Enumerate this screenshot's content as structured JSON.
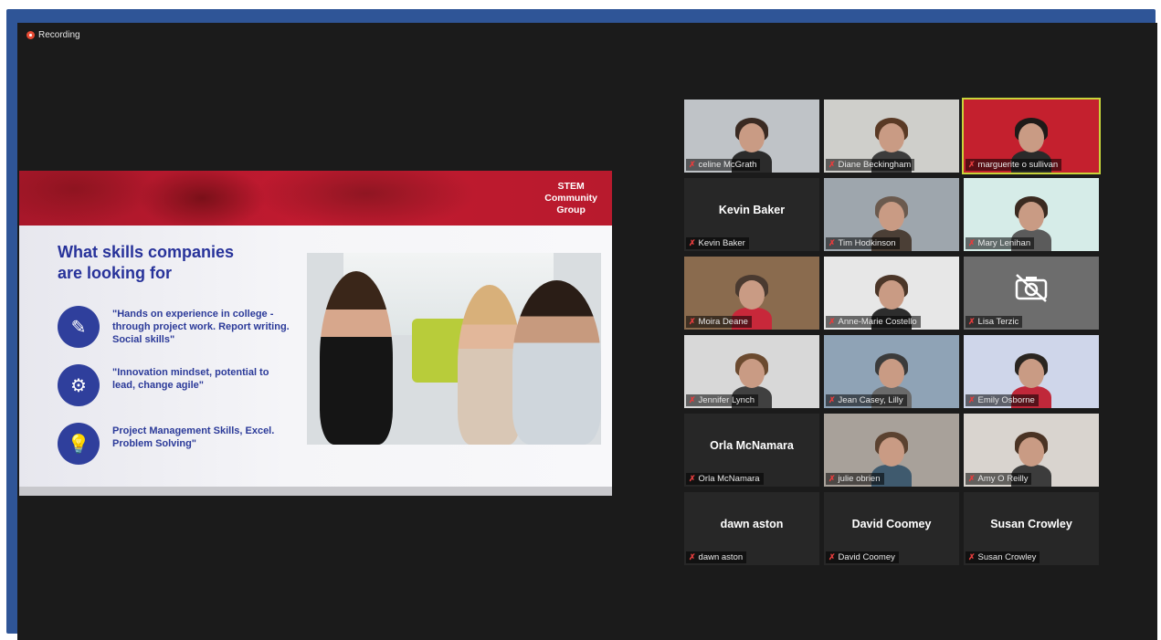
{
  "recording": {
    "label": "Recording"
  },
  "slide": {
    "brand": [
      "STEM",
      "Community",
      "Group"
    ],
    "title": [
      "What skills companies",
      "are looking for"
    ],
    "points": [
      {
        "icon": "document-icon",
        "glyph": "✎",
        "text": "\"Hands on experience in college - through project work.  Report writing.  Social skills\""
      },
      {
        "icon": "gears-icon",
        "glyph": "⚙",
        "text": "\"Innovation mindset, potential to lead, change agile\""
      },
      {
        "icon": "lightbulb-icon",
        "glyph": "💡",
        "text": "Project Management Skills, Excel. Problem Solving\""
      }
    ]
  },
  "participants": [
    {
      "name": "celine McGrath",
      "video": true,
      "bg": "#bfc3c7",
      "hair": "#3a2a22",
      "shirt": "#2b2b2b"
    },
    {
      "name": "Diane Beckingham",
      "video": true,
      "bg": "#cfcfcb",
      "hair": "#5a3a25",
      "shirt": "#3c3c3c"
    },
    {
      "name": "marguerite o sullivan",
      "video": true,
      "bg": "#c4202e",
      "hair": "#1e1a18",
      "shirt": "#2a2a2a",
      "speaking": true
    },
    {
      "name": "Kevin Baker",
      "video": false
    },
    {
      "name": "Tim Hodkinson",
      "video": true,
      "bg": "#9ea6ad",
      "hair": "#6b5a4e",
      "shirt": "#4b3f36"
    },
    {
      "name": "Mary Lenihan",
      "video": true,
      "bg": "#d6ece8",
      "hair": "#3b2a20",
      "shirt": "#5b5b5b"
    },
    {
      "name": "Moira Deane",
      "video": true,
      "bg": "#8a6b4e",
      "hair": "#4a3a30",
      "shirt": "#c8283a"
    },
    {
      "name": "Anne-Marie Costello",
      "video": true,
      "bg": "#e7e7e7",
      "hair": "#4b3628",
      "shirt": "#2d2d2d"
    },
    {
      "name": "Lisa Terzic",
      "video": false,
      "cam_off": true
    },
    {
      "name": "Jennifer Lynch",
      "video": true,
      "bg": "#d8d8d8",
      "hair": "#6b4a2f",
      "shirt": "#404040"
    },
    {
      "name": "Jean Casey, Lilly",
      "video": true,
      "bg": "#8fa3b6",
      "hair": "#3b3b3b",
      "shirt": "#6a6a6a"
    },
    {
      "name": "Emily Osborne",
      "video": true,
      "bg": "#cfd6ea",
      "hair": "#2a2520",
      "shirt": "#c0283a"
    },
    {
      "name": "Orla McNamara",
      "video": false
    },
    {
      "name": "julie obrien",
      "video": true,
      "bg": "#a8a19a",
      "hair": "#5b4230",
      "shirt": "#3f5a6e"
    },
    {
      "name": "Amy O Reilly",
      "video": true,
      "bg": "#d9d4cf",
      "hair": "#4a3324",
      "shirt": "#3c3c3c"
    },
    {
      "name": "dawn aston",
      "video": false
    },
    {
      "name": "David Coomey",
      "video": false
    },
    {
      "name": "Susan Crowley",
      "video": false
    }
  ]
}
